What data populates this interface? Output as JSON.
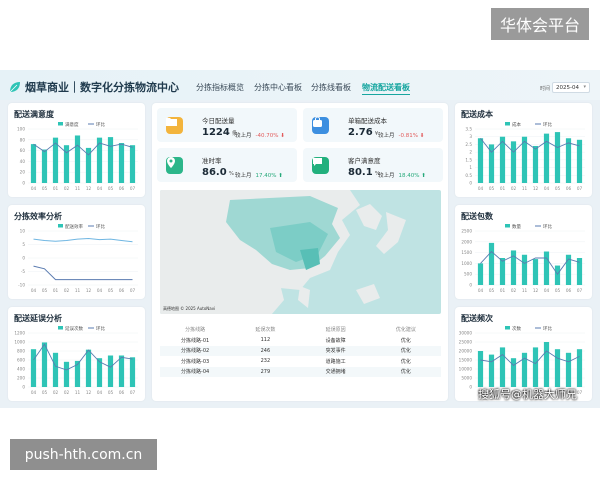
{
  "watermarks": {
    "top_right": "华体会平台",
    "bottom_left": "push-hth.com.cn",
    "sohu": "搜狐号@机器大师兄"
  },
  "header": {
    "title": "烟草商业｜数字化分拣物流中心",
    "nav": [
      "分拣指标概览",
      "分拣中心看板",
      "分拣线看板",
      "物流配送看板"
    ],
    "active_nav": 3,
    "date_label": "时间",
    "date_value": "2025-04"
  },
  "colors": {
    "accent": "#2ec4b6",
    "line": "#5a7bb0",
    "down": "#e25b5b",
    "up": "#26a97a"
  },
  "left_panels": [
    {
      "title": "配送满意度",
      "legend": [
        "满意度",
        "环比"
      ],
      "y_ticks": [
        "100",
        "80",
        "60",
        "40",
        "20",
        "0"
      ],
      "categories": [
        "04",
        "05",
        "01",
        "02",
        "11",
        "12",
        "04",
        "05",
        "06",
        "07"
      ],
      "bars": [
        72,
        62,
        84,
        70,
        88,
        65,
        84,
        85,
        74,
        70
      ],
      "line": [
        72,
        58,
        74,
        56,
        70,
        52,
        74,
        68,
        72,
        66
      ],
      "ymax": 100
    },
    {
      "title": "分拣效率分析",
      "legend": [
        "配送效率",
        "环比"
      ],
      "y_ticks": [
        "10",
        "5",
        "0",
        "-5",
        "-10"
      ],
      "categories": [
        "04",
        "05",
        "01",
        "02",
        "11",
        "12",
        "04",
        "05",
        "06",
        "07"
      ],
      "series_a": [
        7,
        6.5,
        6.2,
        6.5,
        7,
        7.2,
        6.8,
        7,
        6.5,
        6
      ],
      "series_b": [
        -3,
        -4,
        -8,
        -8,
        -8,
        -8,
        -8,
        -8,
        -8,
        -8
      ],
      "ymin": -10,
      "ymax": 10
    },
    {
      "title": "配送延误分析",
      "legend": [
        "延误次数",
        "环比"
      ],
      "y_ticks": [
        "1200",
        "1000",
        "800",
        "600",
        "400",
        "200",
        "0"
      ],
      "categories": [
        "04",
        "05",
        "02",
        "02",
        "11",
        "12",
        "04",
        "05",
        "06",
        "07"
      ],
      "bars": [
        840,
        990,
        760,
        560,
        580,
        830,
        640,
        700,
        700,
        660
      ],
      "line": [
        600,
        950,
        460,
        380,
        500,
        820,
        560,
        440,
        660,
        620
      ],
      "ymax": 1200
    }
  ],
  "kpis": [
    {
      "label": "今日配送量",
      "value": "1224",
      "unit": "条",
      "cmp_label": "较上月",
      "pct": "-40.70%",
      "trend": "down",
      "icon": "folder-icon",
      "color": "#f3b43c"
    },
    {
      "label": "单箱配送成本",
      "value": "2.76",
      "unit": "¥",
      "cmp_label": "较上月",
      "pct": "-0.81%",
      "trend": "down",
      "icon": "bag-icon",
      "color": "#3d8fe0"
    },
    {
      "label": "准时率",
      "value": "86.0",
      "unit": "%",
      "cmp_label": "较上月",
      "pct": "17.40%",
      "trend": "up",
      "icon": "location-icon",
      "color": "#2cb68a"
    },
    {
      "label": "客户满意度",
      "value": "80.1",
      "unit": "%",
      "cmp_label": "较上月",
      "pct": "18.40%",
      "trend": "up",
      "icon": "chat-icon",
      "color": "#22b07d"
    }
  ],
  "map": {
    "credit": "高德地图  © 2025 AutoNavi"
  },
  "table": {
    "headers": [
      "分拣线路",
      "延误次数",
      "延误原因",
      "优化建议"
    ],
    "rows": [
      [
        "分拣线路-01",
        "112",
        "设备故障",
        "优化"
      ],
      [
        "分拣线路-02",
        "246",
        "突发事件",
        "优化"
      ],
      [
        "分拣线路-03",
        "232",
        "道路施工",
        "优化"
      ],
      [
        "分拣线路-04",
        "279",
        "交通拥堵",
        "优化"
      ]
    ]
  },
  "right_panels": [
    {
      "title": "配送成本",
      "legend": [
        "成本",
        "环比"
      ],
      "y_ticks": [
        "3.5",
        "3",
        "2.5",
        "2",
        "1.5",
        "1",
        "0.5",
        "0"
      ],
      "categories": [
        "04",
        "05",
        "01",
        "02",
        "11",
        "12",
        "04",
        "05",
        "06",
        "07"
      ],
      "bars": [
        2.9,
        2.5,
        3.0,
        2.7,
        3.0,
        2.4,
        3.2,
        3.3,
        2.9,
        2.8
      ],
      "line": [
        2.9,
        2.0,
        2.7,
        2.0,
        2.7,
        2.2,
        2.7,
        2.3,
        2.6,
        2.4
      ],
      "ymax": 3.5
    },
    {
      "title": "配送包数",
      "legend": [
        "数量",
        "环比"
      ],
      "y_ticks": [
        "2500",
        "2000",
        "1500",
        "1000",
        "500",
        "0"
      ],
      "categories": [
        "04",
        "05",
        "01",
        "02",
        "11",
        "12",
        "04",
        "05",
        "06",
        "07"
      ],
      "bars": [
        1000,
        1950,
        1250,
        1600,
        1400,
        1200,
        1550,
        900,
        1400,
        1250
      ],
      "line": [
        1000,
        1550,
        1100,
        1350,
        1000,
        1250,
        1250,
        500,
        1200,
        1050
      ],
      "ymax": 2500
    },
    {
      "title": "配送频次",
      "legend": [
        "次数",
        "环比"
      ],
      "y_ticks": [
        "30000",
        "25000",
        "20000",
        "15000",
        "10000",
        "5000",
        "0"
      ],
      "categories": [
        "04",
        "05",
        "01",
        "02",
        "11",
        "12",
        "04",
        "05",
        "06",
        "07"
      ],
      "bars": [
        20000,
        18000,
        22000,
        16000,
        19000,
        22000,
        25000,
        21000,
        19000,
        21000
      ],
      "line": [
        15000,
        14000,
        18000,
        12000,
        16000,
        13000,
        20000,
        16000,
        14000,
        17000
      ],
      "ymax": 30000
    }
  ]
}
